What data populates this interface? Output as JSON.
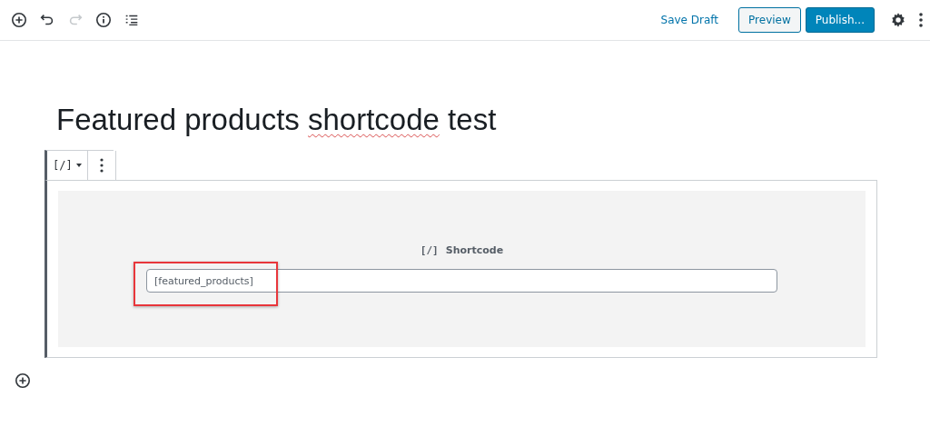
{
  "toolbar": {
    "tools": [
      {
        "kind": "add",
        "disabled": false
      },
      {
        "kind": "undo",
        "disabled": false
      },
      {
        "kind": "redo",
        "disabled": true
      },
      {
        "kind": "info",
        "disabled": false
      },
      {
        "kind": "outline",
        "disabled": false
      }
    ],
    "save_draft": "Save Draft",
    "preview": "Preview",
    "publish": "Publish..."
  },
  "title": [
    {
      "text": "Featured products ",
      "misspelled": false
    },
    {
      "text": "shortcode",
      "misspelled": true
    },
    {
      "text": " test",
      "misspelled": false
    }
  ],
  "block_toolbar": {
    "block_type": "[/]"
  },
  "block": {
    "icon": "[/]",
    "label": "Shortcode",
    "value": "[featured_products]",
    "highlighted": true
  }
}
